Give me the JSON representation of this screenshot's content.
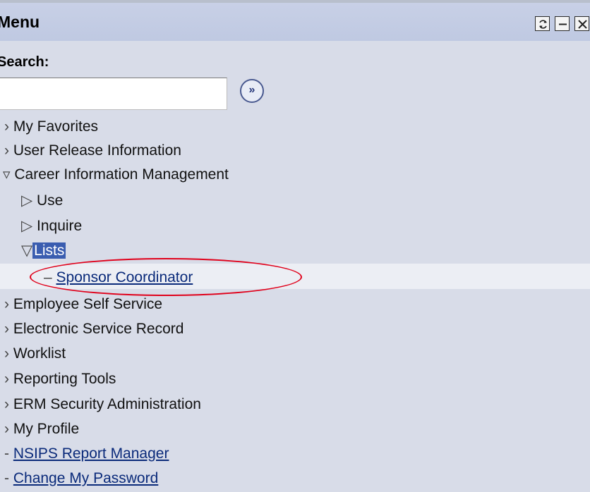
{
  "header": {
    "title": "Menu",
    "buttons": [
      {
        "name": "refresh-button",
        "icon": "refresh-icon"
      },
      {
        "name": "minimize-button",
        "icon": "minimize-icon"
      },
      {
        "name": "close-button",
        "icon": "close-icon"
      }
    ]
  },
  "search": {
    "label": "Search:",
    "value": "",
    "go_label": "»"
  },
  "menu": {
    "items": [
      {
        "label": "My Favorites",
        "level": 0,
        "state": "collapsed"
      },
      {
        "label": "User Release Information",
        "level": 0,
        "state": "collapsed"
      },
      {
        "label": "Career Information Management",
        "level": 0,
        "state": "expanded"
      },
      {
        "label": "Use",
        "level": 1,
        "state": "collapsed"
      },
      {
        "label": "Inquire",
        "level": 1,
        "state": "collapsed"
      },
      {
        "label": "Lists",
        "level": 1,
        "state": "expanded",
        "selected": true
      },
      {
        "label": "Sponsor Coordinator",
        "level": 2,
        "type": "link",
        "highlighted": true
      },
      {
        "label": "Employee Self Service",
        "level": 0,
        "state": "collapsed"
      },
      {
        "label": "Electronic Service Record",
        "level": 0,
        "state": "collapsed"
      },
      {
        "label": "Worklist",
        "level": 0,
        "state": "collapsed"
      },
      {
        "label": "Reporting Tools",
        "level": 0,
        "state": "collapsed"
      },
      {
        "label": "ERM Security Administration",
        "level": 0,
        "state": "collapsed"
      },
      {
        "label": "My Profile",
        "level": 0,
        "state": "collapsed"
      },
      {
        "label": "NSIPS Report Manager",
        "level": 0,
        "type": "link"
      },
      {
        "label": "Change My Password",
        "level": 0,
        "type": "link"
      }
    ]
  },
  "colors": {
    "header_bg": "#c4cde4",
    "panel_bg": "#d8dce8",
    "selection_bg": "#3a5db0",
    "link": "#0a2a7a",
    "callout": "#e0001a"
  }
}
